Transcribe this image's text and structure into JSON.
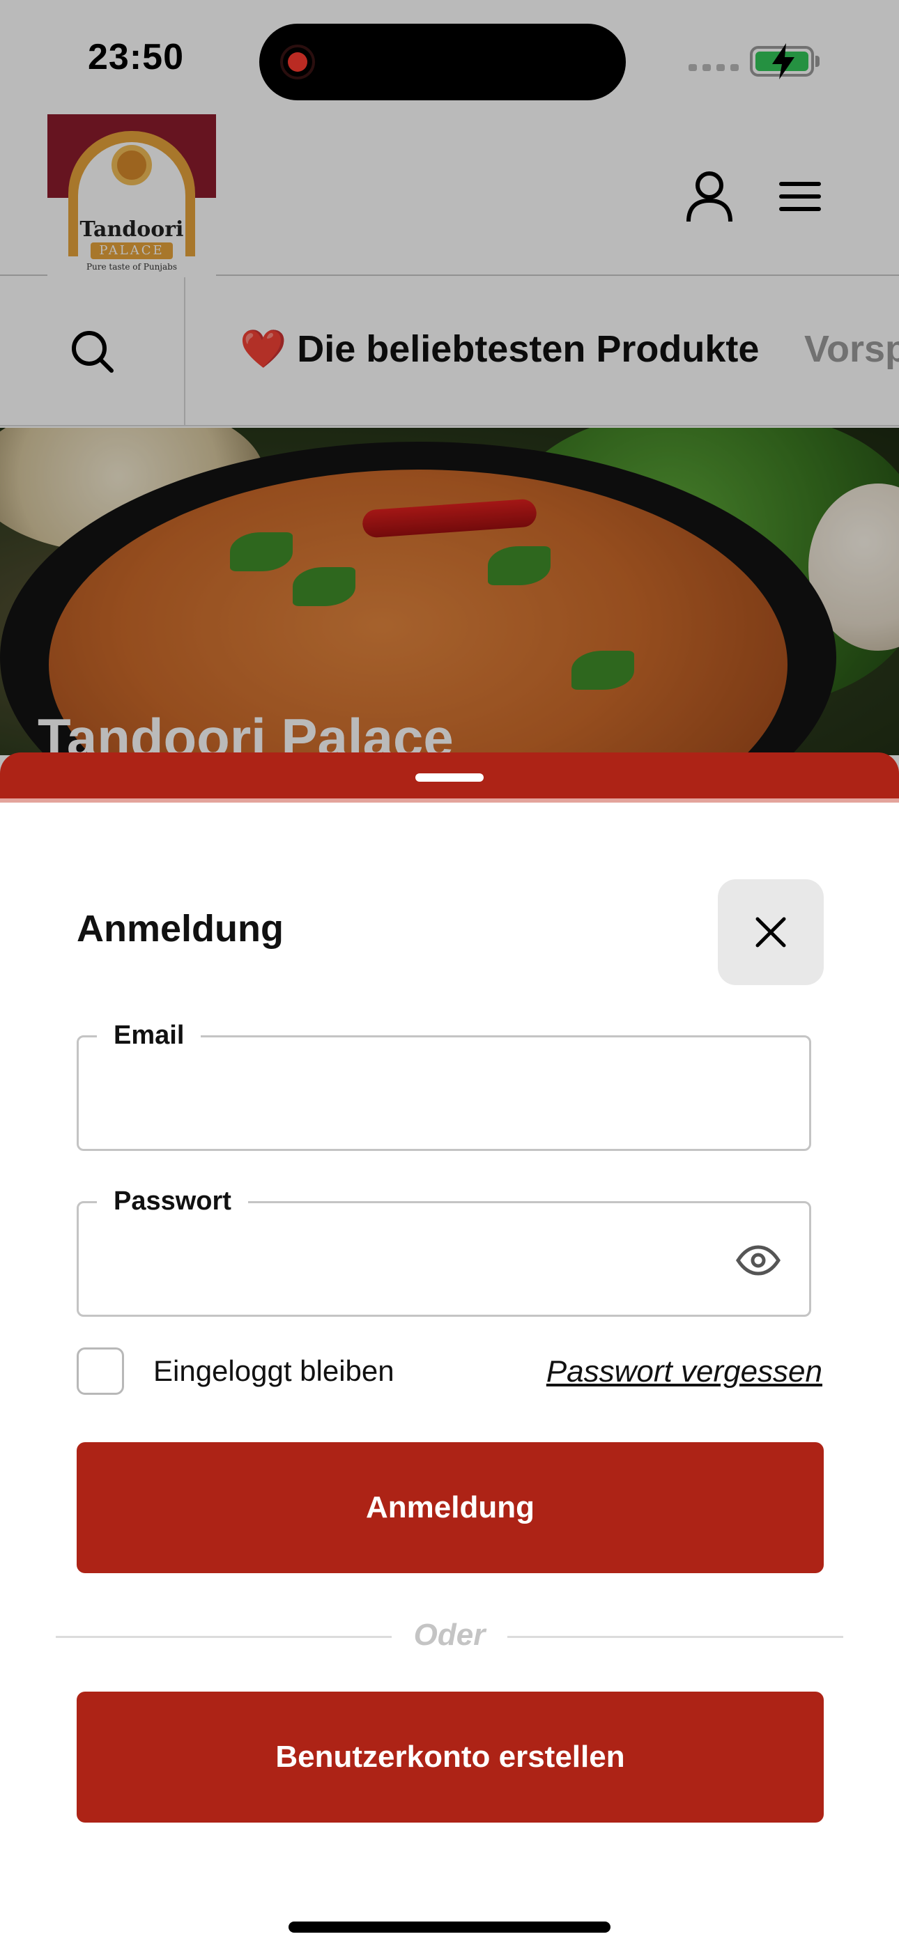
{
  "status_bar": {
    "time": "23:50"
  },
  "header": {
    "logo": {
      "name": "Tandoori",
      "subname": "PALACE",
      "tagline": "Pure taste of Punjabs"
    }
  },
  "categories": {
    "items": [
      {
        "label": "❤️ Die beliebtesten Produkte"
      },
      {
        "label": "Vorsp"
      }
    ]
  },
  "hero": {
    "title": "Tandoori Palace"
  },
  "login_sheet": {
    "title": "Anmeldung",
    "email_label": "Email",
    "email_value": "",
    "password_label": "Passwort",
    "password_value": "",
    "remember_label": "Eingeloggt bleiben",
    "remember_checked": false,
    "forgot_label": "Passwort vergessen",
    "login_button": "Anmeldung",
    "divider_text": "Oder",
    "register_button": "Benutzerkonto erstellen"
  },
  "icons": {
    "close": "close-icon",
    "eye": "eye-icon",
    "search": "search-icon",
    "user": "user-icon",
    "menu": "menu-icon"
  },
  "colors": {
    "accent": "#ad2316",
    "close_button_bg": "#e8e8e8",
    "divider_text": "#c4c4c4"
  }
}
